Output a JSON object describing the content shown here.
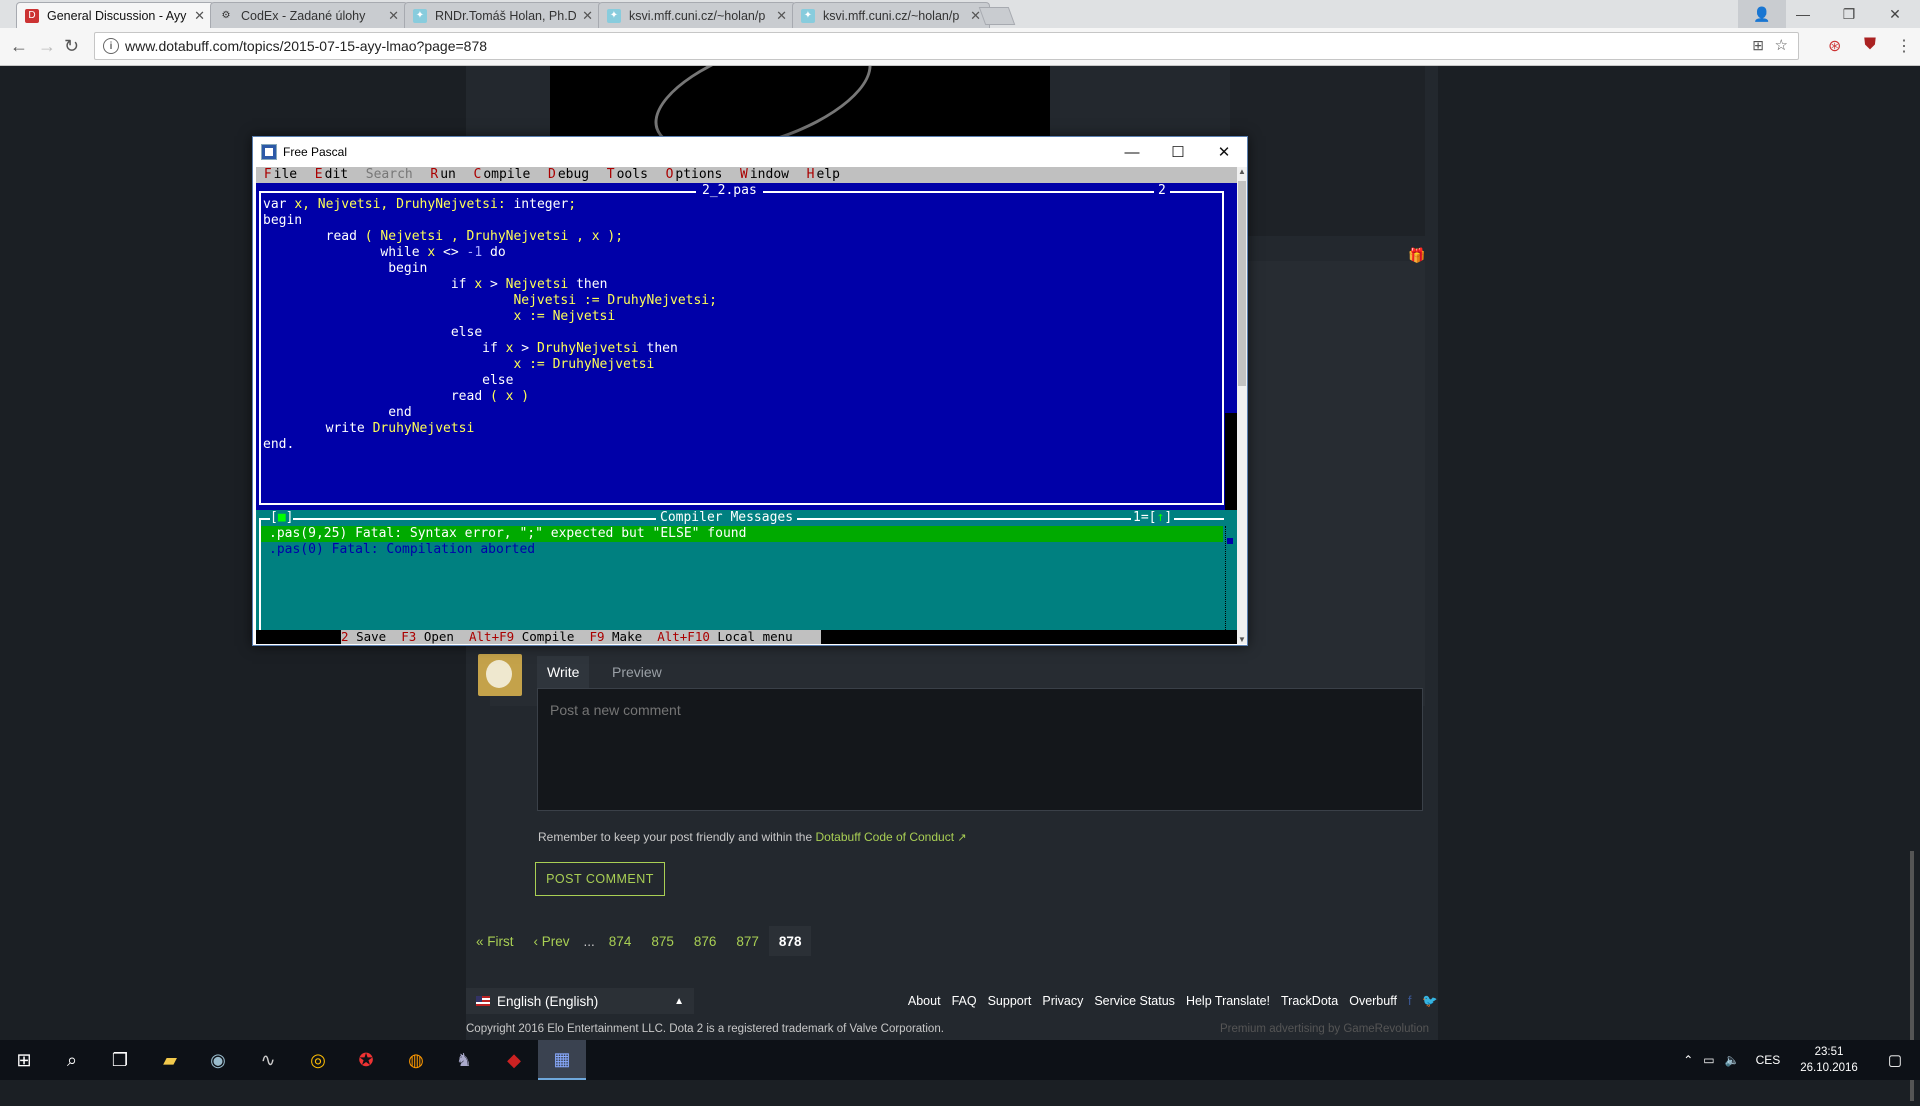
{
  "browser": {
    "tabs": [
      {
        "title": "General Discussion - Ayy",
        "icon": "dotabuff-icon",
        "active": true
      },
      {
        "title": "CodEx - Zadané úlohy",
        "icon": "codex-icon",
        "active": false
      },
      {
        "title": "RNDr.Tomáš Holan, Ph.D.",
        "icon": "page-icon",
        "active": false
      },
      {
        "title": "ksvi.mff.cuni.cz/~holan/p",
        "icon": "page-icon",
        "active": false
      },
      {
        "title": "ksvi.mff.cuni.cz/~holan/p",
        "icon": "page-icon",
        "active": false
      }
    ],
    "url": "www.dotabuff.com/topics/2015-07-15-ayy-lmao?page=878"
  },
  "freepascal": {
    "window_title": "Free Pascal",
    "menu": [
      "File",
      "Edit",
      "Search",
      "Run",
      "Compile",
      "Debug",
      "Tools",
      "Options",
      "Window",
      "Help"
    ],
    "editor_title": "2_2.pas",
    "editor_number": "2",
    "code_lines": [
      "var x, Nejvetsi, DruhyNejvetsi: integer;",
      "begin",
      "        read ( Nejvetsi , DruhyNejvetsi , x );",
      "               while x <> -1 do",
      "                begin",
      "                        if x > Nejvetsi then",
      "                                Nejvetsi := DruhyNejvetsi;",
      "                                x := Nejvetsi",
      "                        else",
      "                            if x > DruhyNejvetsi then",
      "                                x := DruhyNejvetsi",
      "                            else",
      "                        read ( x )",
      "                end",
      "        write DruhyNejvetsi",
      "end."
    ],
    "messages_title": "Compiler Messages",
    "messages_number": "1",
    "messages": [
      ".pas(9,25) Fatal: Syntax error, \";\" expected but \"ELSE\" found",
      ".pas(0) Fatal: Compilation aborted"
    ],
    "status_items": [
      {
        "key": "2",
        "label": "Save"
      },
      {
        "key": "F3",
        "label": "Open"
      },
      {
        "key": "Alt+F9",
        "label": "Compile"
      },
      {
        "key": "F9",
        "label": "Make"
      },
      {
        "key": "Alt+F10",
        "label": "Local menu"
      }
    ]
  },
  "comment": {
    "write_tab": "Write",
    "preview_tab": "Preview",
    "placeholder": "Post a new comment",
    "reminder_text": "Remember to keep your post friendly and within the",
    "reminder_link": "Dotabuff Code of Conduct",
    "post_button": "POST COMMENT"
  },
  "pagination": {
    "first": "« First",
    "prev": "‹ Prev",
    "ellipsis": "...",
    "pages": [
      "874",
      "875",
      "876",
      "877",
      "878"
    ],
    "current": "878"
  },
  "footer": {
    "language": "English (English)",
    "links": [
      "About",
      "FAQ",
      "Support",
      "Privacy",
      "Service Status",
      "Help Translate!",
      "TrackDota",
      "Overbuff"
    ],
    "copyright": "Copyright 2016 Elo Entertainment LLC. Dota 2 is a registered trademark of Valve Corporation.",
    "advert": "Premium advertising by GameRevolution"
  },
  "taskbar": {
    "lang": "CES",
    "time": "23:51",
    "date": "26.10.2016"
  },
  "colors": {
    "accent": "#a9cf54",
    "pascal_editor_bg": "#0000a8",
    "pascal_messages_bg": "#008080",
    "pascal_error_highlight": "#00aa00"
  }
}
